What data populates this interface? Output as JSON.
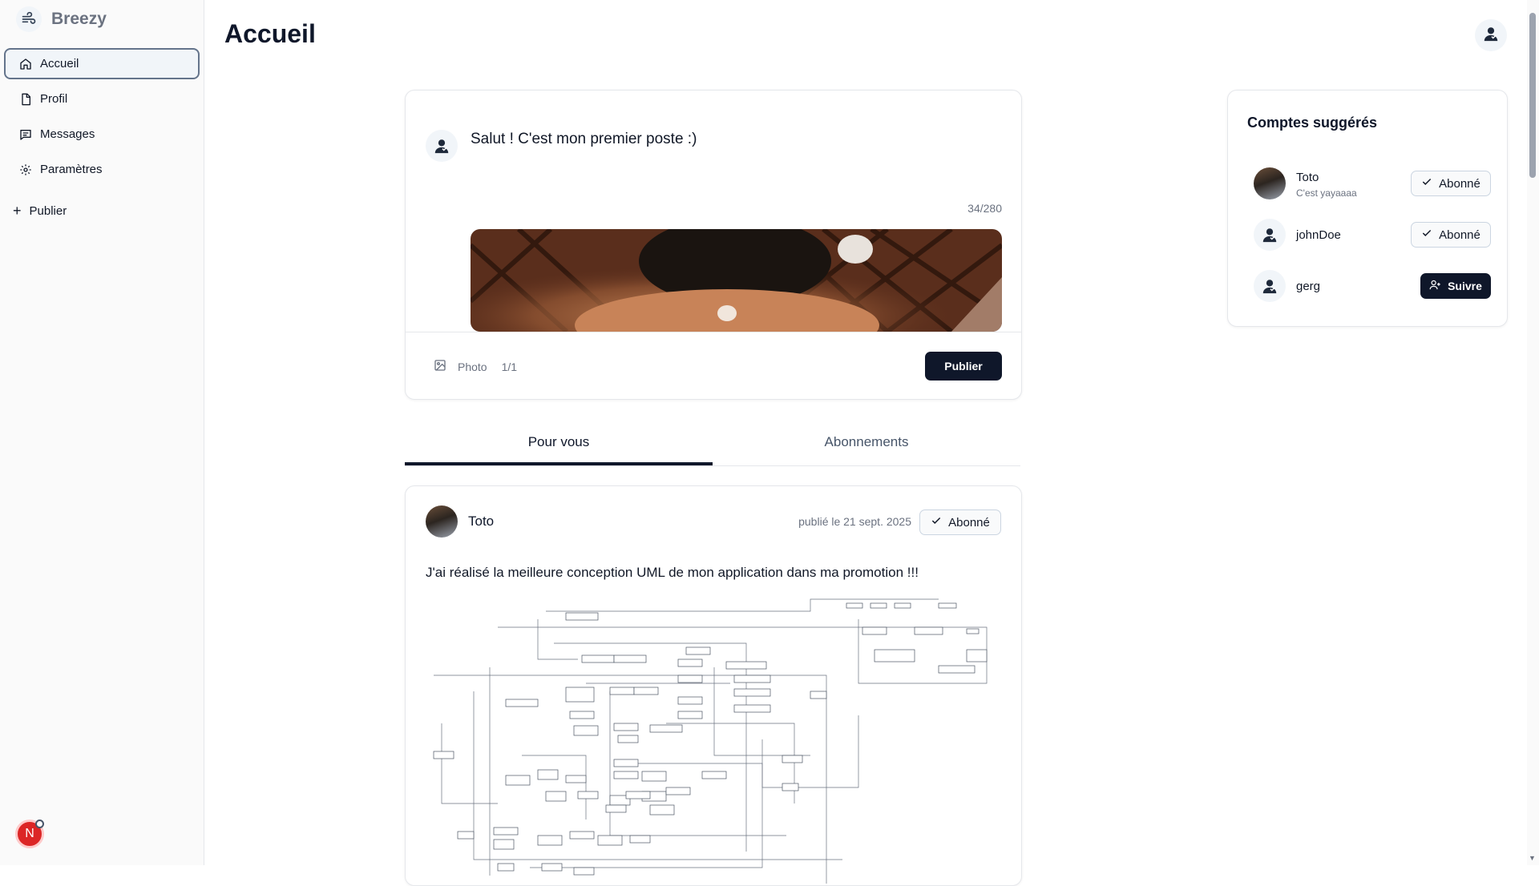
{
  "app": {
    "name": "Breezy"
  },
  "sidebar": {
    "items": [
      {
        "label": "Accueil",
        "icon": "home-icon"
      },
      {
        "label": "Profil",
        "icon": "file-icon"
      },
      {
        "label": "Messages",
        "icon": "message-icon"
      },
      {
        "label": "Paramètres",
        "icon": "gear-icon"
      }
    ],
    "publish_label": "Publier",
    "user_initial": "N"
  },
  "header": {
    "title": "Accueil"
  },
  "composer": {
    "text": "Salut ! C'est mon premier poste :)",
    "counter": "34/280",
    "photo_label": "Photo",
    "photo_count": "1/1",
    "publish_label": "Publier"
  },
  "tabs": [
    {
      "label": "Pour vous"
    },
    {
      "label": "Abonnements"
    }
  ],
  "post": {
    "author": "Toto",
    "date": "publié le 21 sept. 2025",
    "follow_label": "Abonné",
    "content": "J'ai réalisé la meilleure conception UML de mon application dans ma promotion !!!"
  },
  "suggestions": {
    "title": "Comptes suggérés",
    "accounts": [
      {
        "name": "Toto",
        "bio": "C'est yayaaaa",
        "action": "Abonné"
      },
      {
        "name": "johnDoe",
        "action": "Abonné"
      },
      {
        "name": "gerg",
        "action": "Suivre"
      }
    ]
  },
  "colors": {
    "accent": "#0f172a",
    "badge": "#dc2626"
  }
}
